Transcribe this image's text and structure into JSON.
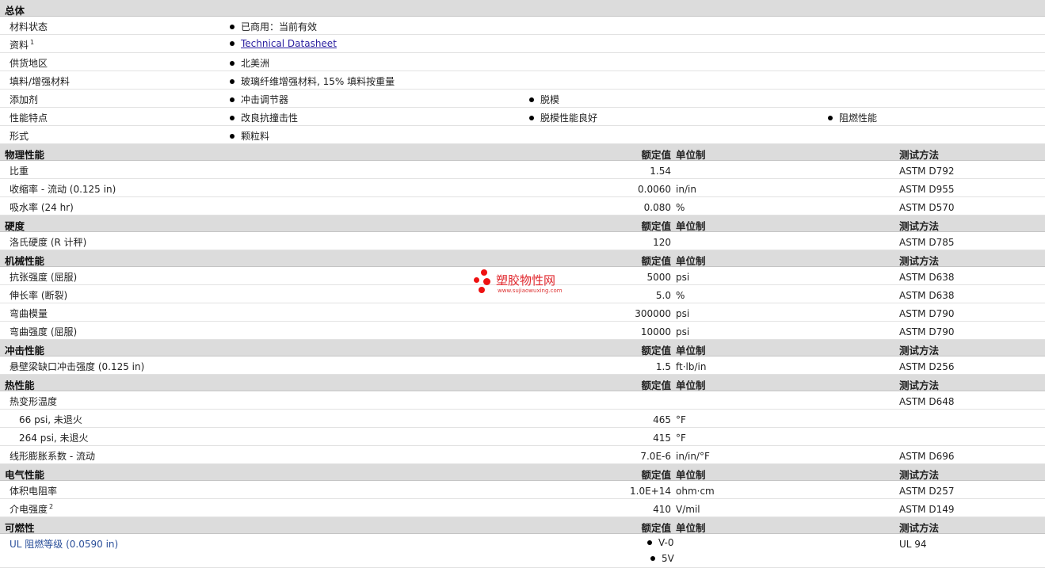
{
  "general": {
    "title": "总体",
    "rows": [
      {
        "label": "材料状态",
        "items": [
          "已商用：当前有效"
        ]
      },
      {
        "label": "资料",
        "sup": "1",
        "items": [
          "Technical Datasheet"
        ],
        "link": true
      },
      {
        "label": "供货地区",
        "items": [
          "北美洲"
        ]
      },
      {
        "label": "填料/增强材料",
        "items": [
          "玻璃纤维增强材料, 15% 填料按重量"
        ]
      },
      {
        "label": "添加剂",
        "items": [
          "冲击调节器",
          "脱模"
        ]
      },
      {
        "label": "性能特点",
        "items": [
          "改良抗撞击性",
          "脱模性能良好",
          "阻燃性能"
        ]
      },
      {
        "label": "形式",
        "items": [
          "颗粒料"
        ]
      }
    ]
  },
  "headers": {
    "value": "额定值",
    "unit": "单位制",
    "method": "测试方法"
  },
  "sections": [
    {
      "title": "物理性能",
      "rows": [
        {
          "label": "比重",
          "value": "1.54",
          "unit": "",
          "method": "ASTM D792"
        },
        {
          "label": "收缩率 - 流动 (0.125 in)",
          "value": "0.0060",
          "unit": "in/in",
          "method": "ASTM D955"
        },
        {
          "label": "吸水率 (24 hr)",
          "value": "0.080",
          "unit": "%",
          "method": "ASTM D570"
        }
      ]
    },
    {
      "title": "硬度",
      "rows": [
        {
          "label": "洛氏硬度 (R 计秤)",
          "value": "120",
          "unit": "",
          "method": "ASTM D785"
        }
      ]
    },
    {
      "title": "机械性能",
      "rows": [
        {
          "label": "抗张强度 (屈服)",
          "value": "5000",
          "unit": "psi",
          "method": "ASTM D638"
        },
        {
          "label": "伸长率 (断裂)",
          "value": "5.0",
          "unit": "%",
          "method": "ASTM D638"
        },
        {
          "label": "弯曲模量",
          "value": "300000",
          "unit": "psi",
          "method": "ASTM D790"
        },
        {
          "label": "弯曲强度 (屈服)",
          "value": "10000",
          "unit": "psi",
          "method": "ASTM D790"
        }
      ]
    },
    {
      "title": "冲击性能",
      "rows": [
        {
          "label": "悬壁梁缺口冲击强度 (0.125 in)",
          "value": "1.5",
          "unit": "ft·lb/in",
          "method": "ASTM D256"
        }
      ]
    },
    {
      "title": "热性能",
      "rows": [
        {
          "label": "热变形温度",
          "value": "",
          "unit": "",
          "method": "ASTM D648"
        },
        {
          "label": "66 psi, 未退火",
          "value": "465",
          "unit": "°F",
          "method": "",
          "indent": true
        },
        {
          "label": "264 psi, 未退火",
          "value": "415",
          "unit": "°F",
          "method": "",
          "indent": true
        },
        {
          "label": "线形膨胀系数 - 流动",
          "value": "7.0E-6",
          "unit": "in/in/°F",
          "method": "ASTM D696"
        }
      ]
    },
    {
      "title": "电气性能",
      "rows": [
        {
          "label": "体积电阻率",
          "value": "1.0E+14",
          "unit": "ohm·cm",
          "method": "ASTM D257"
        },
        {
          "label": "介电强度",
          "sup": "2",
          "value": "410",
          "unit": "V/mil",
          "method": "ASTM D149"
        }
      ]
    },
    {
      "title": "可燃性",
      "rows": [
        {
          "label": "UL 阻燃等级 (0.0590 in)",
          "bullets": [
            "V-0",
            "5V"
          ],
          "method": "UL 94",
          "ul": true
        }
      ]
    }
  ],
  "watermark": {
    "name": "塑胶物性网",
    "url": "www.sujiaowuxing.com",
    "color": "#e0262c"
  }
}
